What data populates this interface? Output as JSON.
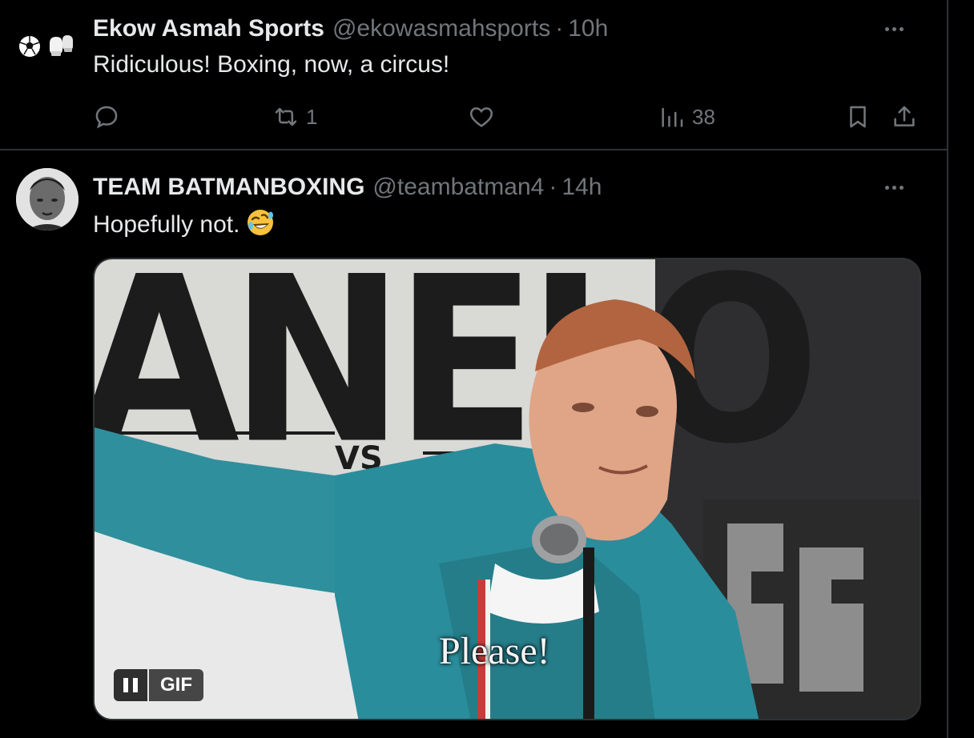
{
  "tweets": [
    {
      "display_name": "Ekow Asmah Sports",
      "handle": "@ekowasmahsports",
      "separator": "·",
      "time": "10h",
      "text": "Ridiculous! Boxing, now, a circus!",
      "avatar_icons": [
        "soccer-ball-icon",
        "boxing-glove-icon"
      ],
      "actions": {
        "reply_count": "",
        "retweet_count": "1",
        "like_count": "",
        "views_count": "38"
      }
    },
    {
      "display_name": "TEAM BATMANBOXING",
      "handle": "@teambatman4",
      "separator": "·",
      "time": "14h",
      "text": "Hopefully not.",
      "emoji": "rolling-on-floor-laughing-emoji",
      "media": {
        "type": "gif",
        "caption": "Please!",
        "badge": "GIF",
        "banner_words": [
          "ANELO",
          "VS"
        ]
      }
    }
  ],
  "colors": {
    "background": "#000000",
    "text_primary": "#e7e9ea",
    "text_secondary": "#71767b",
    "divider": "#2f3336",
    "jacket_teal": "#2a8d9c"
  }
}
